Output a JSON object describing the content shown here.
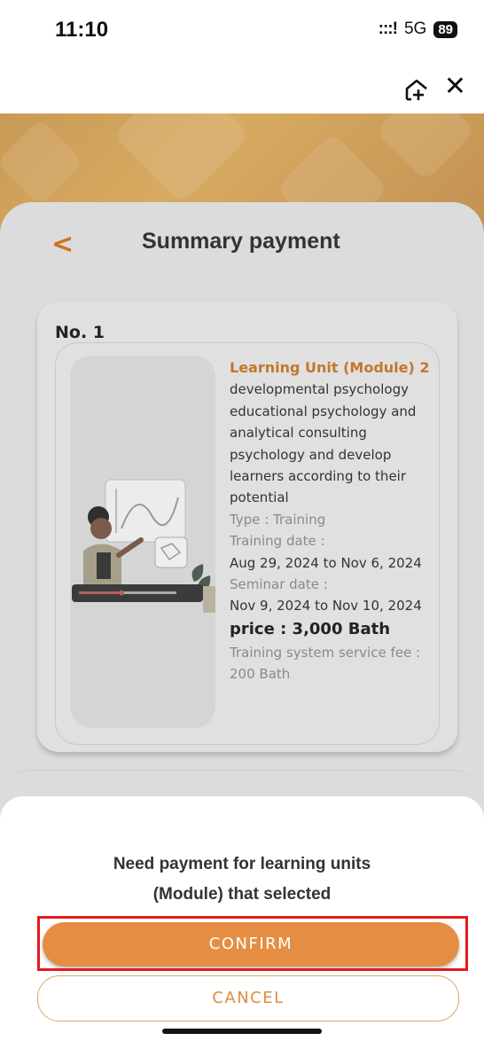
{
  "status_bar": {
    "time": "11:10",
    "signal": ":::!",
    "network": "5G",
    "battery": "89"
  },
  "header": {
    "share_icon": "add-to-home-icon",
    "close_icon": "close-icon",
    "close_glyph": "✕"
  },
  "page": {
    "back_glyph": "<",
    "title": "Summary payment"
  },
  "order": {
    "number_label": "No. 1",
    "module_title": "Learning Unit (Module) 2",
    "description_lines": [
      "developmental psychology",
      "educational psychology and",
      "analytical consulting",
      "psychology and develop",
      "learners according to their",
      "potential"
    ],
    "type": "Type : Training",
    "training_date_label": "Training date :",
    "training_date": "Aug 29, 2024 to Nov 6, 2024",
    "seminar_date_label": "Seminar date :",
    "seminar_date": "Nov 9, 2024 to Nov 10, 2024",
    "price": "price : 3,000 Bath",
    "service_fee_label": "Training system service fee :",
    "service_fee": "200 Bath"
  },
  "dialog": {
    "message_line1": "Need payment for learning units",
    "message_line2": "(Module) that selected",
    "confirm_label": "CONFIRM",
    "cancel_label": "CANCEL"
  },
  "colors": {
    "accent": "#e58e43",
    "highlight": "#e41b1b",
    "module_title": "#c2772c"
  }
}
